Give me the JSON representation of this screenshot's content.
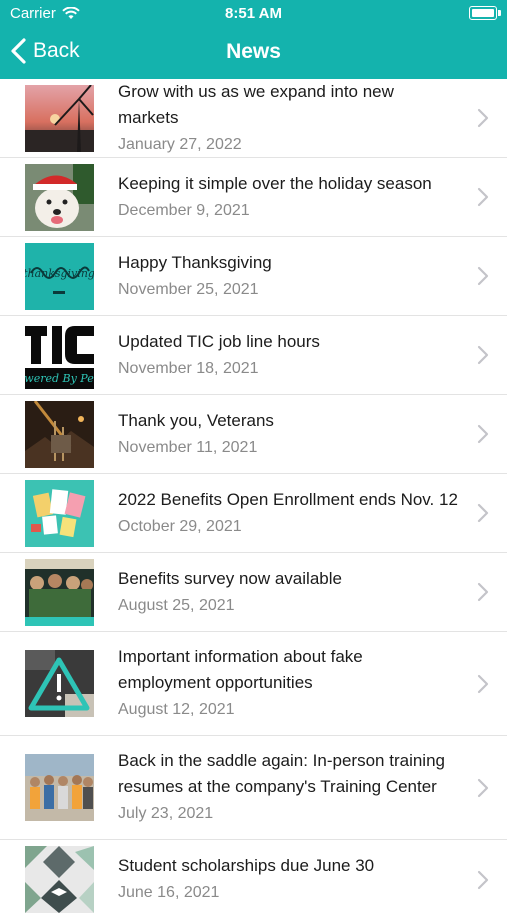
{
  "status_bar": {
    "carrier": "Carrier",
    "time": "8:51 AM"
  },
  "nav": {
    "back_label": "Back",
    "title": "News"
  },
  "colors": {
    "accent": "#14b3ad",
    "date_text": "#8a8a8a"
  },
  "articles": [
    {
      "title": "Grow with us as we expand into new markets",
      "date": "January 27, 2022",
      "thumb": "sunset-wind-turbine"
    },
    {
      "title": "Keeping it simple over the holiday season",
      "date": "December 9, 2021",
      "thumb": "dog-santa-hat"
    },
    {
      "title": "Happy Thanksgiving",
      "date": "November 25, 2021",
      "thumb": "thanksgiving-teal"
    },
    {
      "title": "Updated TIC job line hours",
      "date": "November 18, 2021",
      "thumb": "tic-logo"
    },
    {
      "title": "Thank you, Veterans",
      "date": "November 11, 2021",
      "thumb": "construction-night"
    },
    {
      "title": "2022 Benefits Open Enrollment ends Nov. 12",
      "date": "October 29, 2021",
      "thumb": "benefits-papers"
    },
    {
      "title": "Benefits survey now available",
      "date": "August 25, 2021",
      "thumb": "workers-group"
    },
    {
      "title": "Important information about fake employment opportunities",
      "date": "August 12, 2021",
      "thumb": "warning-triangle"
    },
    {
      "title": "Back in the saddle again: In-person training resumes at the company's Training Center",
      "date": "July 23, 2021",
      "thumb": "training-group"
    },
    {
      "title": "Student scholarships due June 30",
      "date": "June 16, 2021",
      "thumb": "graduation-pattern"
    }
  ]
}
